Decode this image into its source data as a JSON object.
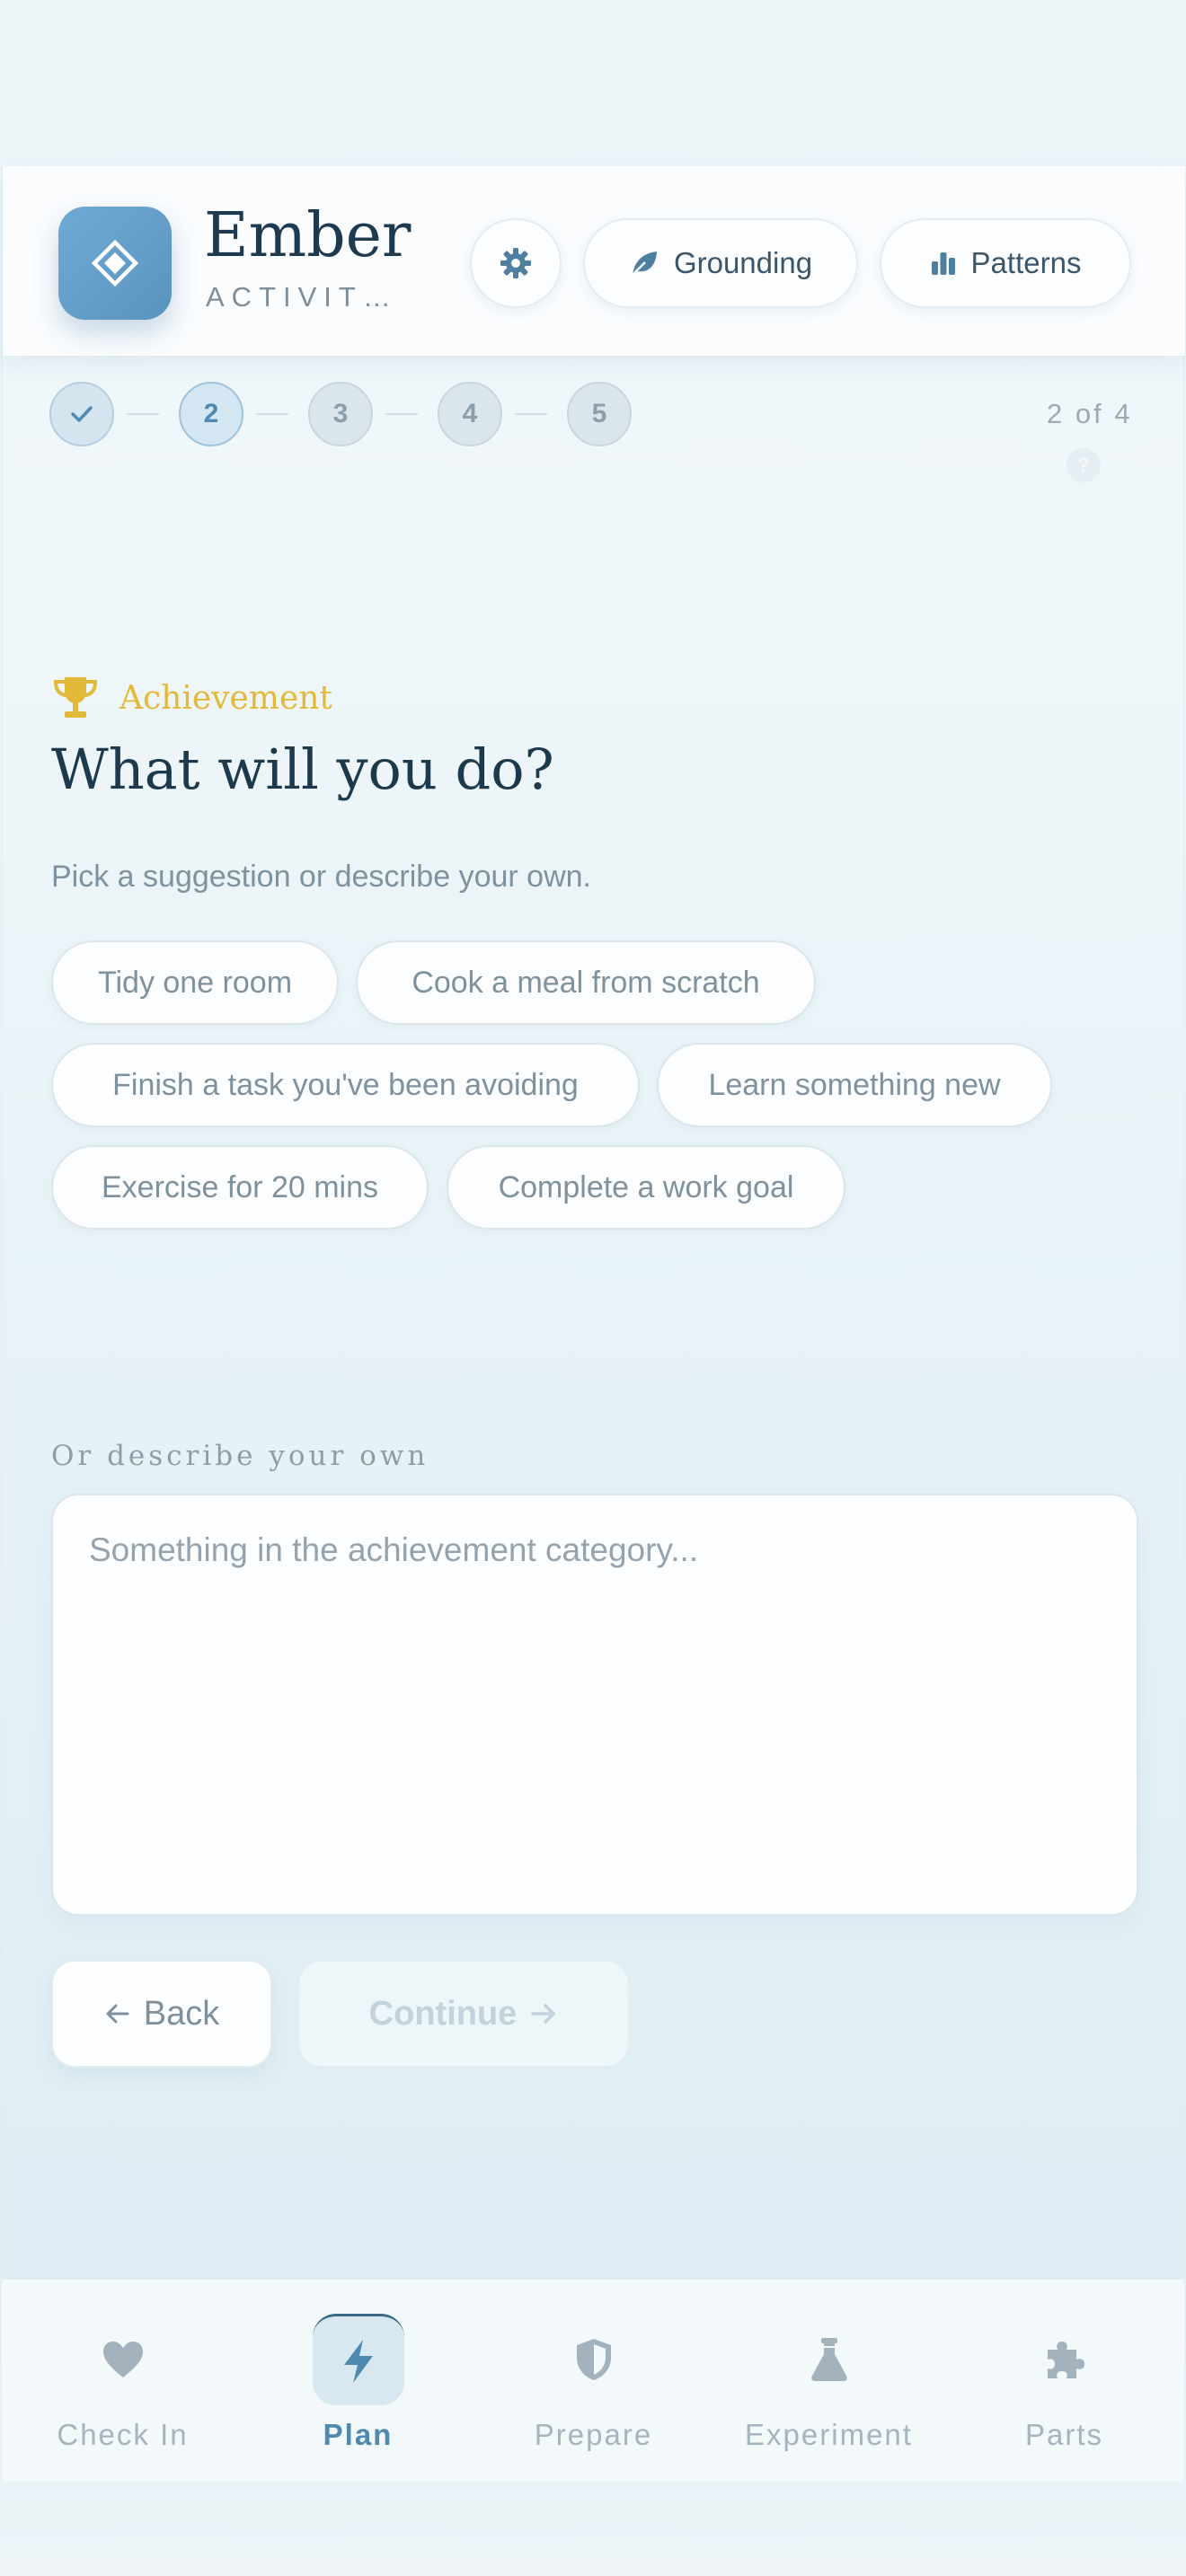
{
  "header": {
    "brand_name": "Ember",
    "brand_subtitle": "ACTIVITY …",
    "settings_icon": "gear-icon",
    "grounding_label": "Grounding",
    "patterns_label": "Patterns"
  },
  "stepper": {
    "steps": [
      "✓",
      "2",
      "3",
      "4",
      "5"
    ],
    "current_step": 2,
    "count_text": "2 of 4",
    "help_icon": "?"
  },
  "main": {
    "category_label": "Achievement",
    "category_icon": "trophy-icon",
    "question": "What will you do?",
    "hint": "Pick a suggestion or describe your own.",
    "suggestions": [
      "Tidy one room",
      "Cook a meal from scratch",
      "Finish a task you've been avoiding",
      "Learn something new",
      "Exercise for 20 mins",
      "Complete a work goal"
    ],
    "own_label": "Or describe your own",
    "own_placeholder": "Something in the achievement category...",
    "back_label": "Back",
    "continue_label": "Continue"
  },
  "bottom_nav": {
    "items": [
      {
        "label": "Check In",
        "icon": "heart-icon"
      },
      {
        "label": "Plan",
        "icon": "lightning-icon"
      },
      {
        "label": "Prepare",
        "icon": "shield-icon"
      },
      {
        "label": "Experiment",
        "icon": "flask-icon"
      },
      {
        "label": "Parts",
        "icon": "puzzle-icon"
      }
    ],
    "active": "Plan"
  },
  "colors": {
    "accent": "#5b93bf",
    "category_gold": "#e3b93a",
    "heading": "#1d3a4d",
    "muted": "#7f929f"
  }
}
